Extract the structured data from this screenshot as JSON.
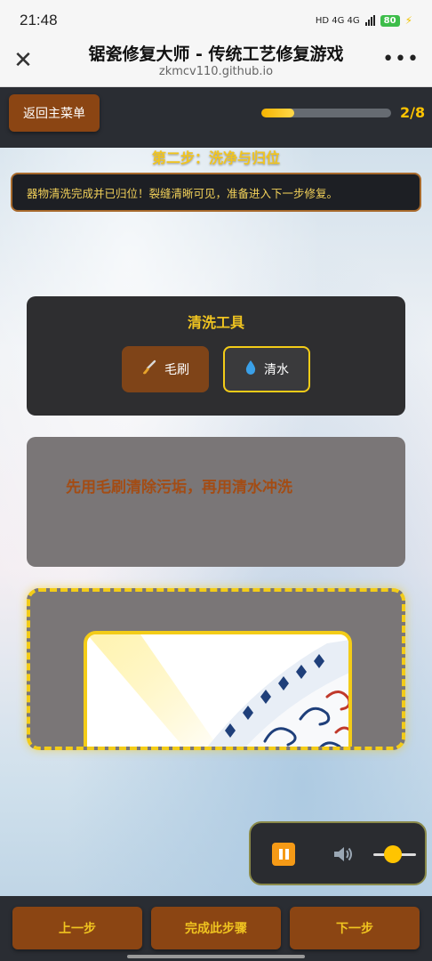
{
  "status_bar": {
    "time": "21:48",
    "network_label": "HD 4G 4G",
    "battery": "80"
  },
  "browser": {
    "title": "锯瓷修复大师 - 传统工艺修复游戏",
    "url": "zkmcv110.github.io",
    "close_icon": "close-icon",
    "more_icon": "more-icon"
  },
  "game": {
    "back_button": "返回主菜单",
    "progress": {
      "current": 2,
      "total": 8,
      "text": "2/8",
      "fraction": 0.25
    },
    "step_title": "第二步：洗净与归位",
    "message": "器物清洗完成并已归位！裂缝清晰可见，准备进入下一步修复。",
    "tools": {
      "title": "清洗工具",
      "items": [
        {
          "label": "毛刷",
          "icon": "brush-icon"
        },
        {
          "label": "清水",
          "icon": "water-drop-icon",
          "selected": true
        }
      ]
    },
    "hint": "先用毛刷清除污垢，再用清水冲洗",
    "audio": {
      "pause_icon": "pause-icon",
      "volume_icon": "speaker-icon",
      "volume_level": 0.5
    },
    "nav": {
      "prev": "上一步",
      "complete": "完成此步骤",
      "next": "下一步"
    }
  },
  "colors": {
    "accent": "#f3cc18",
    "button_brown": "#8b4513",
    "dark_bar": "#2a2d33"
  }
}
